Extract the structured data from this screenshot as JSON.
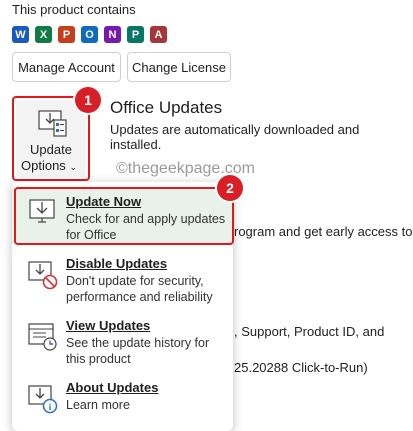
{
  "product": {
    "contains_label": "This product contains"
  },
  "apps": [
    {
      "name": "word-icon",
      "letter": "W",
      "color": "#185abd"
    },
    {
      "name": "excel-icon",
      "letter": "X",
      "color": "#107c41"
    },
    {
      "name": "powerpoint-icon",
      "letter": "P",
      "color": "#c43e1c"
    },
    {
      "name": "outlook-icon",
      "letter": "O",
      "color": "#0f6cbd"
    },
    {
      "name": "onenote-icon",
      "letter": "N",
      "color": "#7719aa"
    },
    {
      "name": "publisher-icon",
      "letter": "P",
      "color": "#077568"
    },
    {
      "name": "access-icon",
      "letter": "A",
      "color": "#a4373a"
    }
  ],
  "buttons": {
    "manage_account": "Manage Account",
    "change_license": "Change License"
  },
  "update_options": {
    "line1": "Update",
    "line2": "Options"
  },
  "updates_section": {
    "title": "Office Updates",
    "subtitle": "Updates are automatically downloaded and installed.",
    "insider_text": "rogram and get early access to",
    "about_text": ", Support, Product ID, and",
    "version_text": "25.20288 Click-to-Run)"
  },
  "watermark": "©thegeekpage.com",
  "callouts": {
    "one": "1",
    "two": "2"
  },
  "menu": {
    "items": [
      {
        "title": "Update Now",
        "desc": "Check for and apply updates for Office"
      },
      {
        "title": "Disable Updates",
        "desc": "Don't update for security, performance and reliability"
      },
      {
        "title": "View Updates",
        "desc": "See the update history for this product"
      },
      {
        "title": "About Updates",
        "desc": "Learn more"
      }
    ]
  },
  "colors": {
    "accent_red": "#e0191f",
    "highlight_bg": "#e8f2ea"
  }
}
